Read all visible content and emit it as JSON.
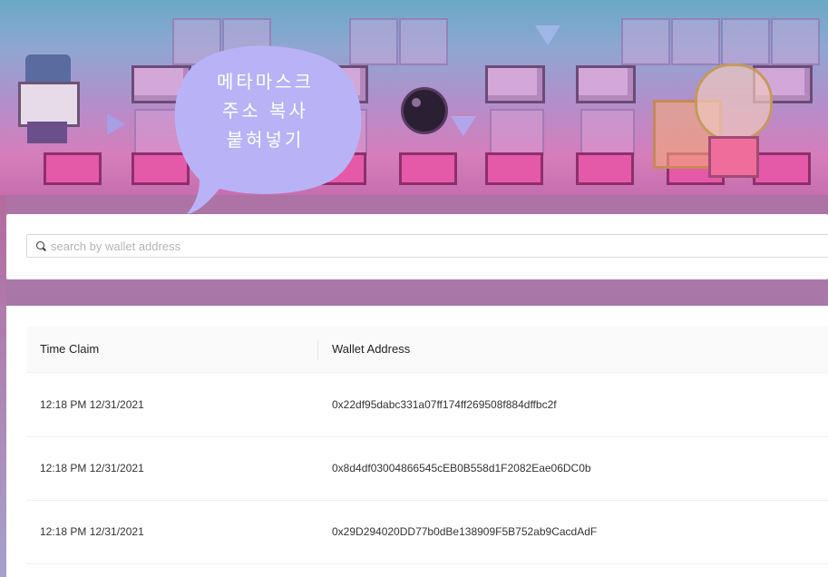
{
  "bubble": {
    "line1": "메타마스크",
    "line2": "주소 복사",
    "line3": "붙혀넣기",
    "color": "#b9b2f7"
  },
  "search": {
    "placeholder": "search by wallet address",
    "value": ""
  },
  "table": {
    "headers": [
      "Time Claim",
      "Wallet Address"
    ],
    "rows": [
      {
        "time": "12:18 PM 12/31/2021",
        "address": "0x22df95dabc331a07ff174ff269508f884dffbc2f"
      },
      {
        "time": "12:18 PM 12/31/2021",
        "address": "0x8d4df03004866545cEB0B558d1F2082Eae06DC0b"
      },
      {
        "time": "12:18 PM 12/31/2021",
        "address": "0x29D294020DD77b0dBe138909F5B752ab9CacdAdF"
      }
    ]
  },
  "colors": {
    "background": "#b46a9d",
    "card": "#ffffff",
    "header_row": "#fafafa"
  }
}
